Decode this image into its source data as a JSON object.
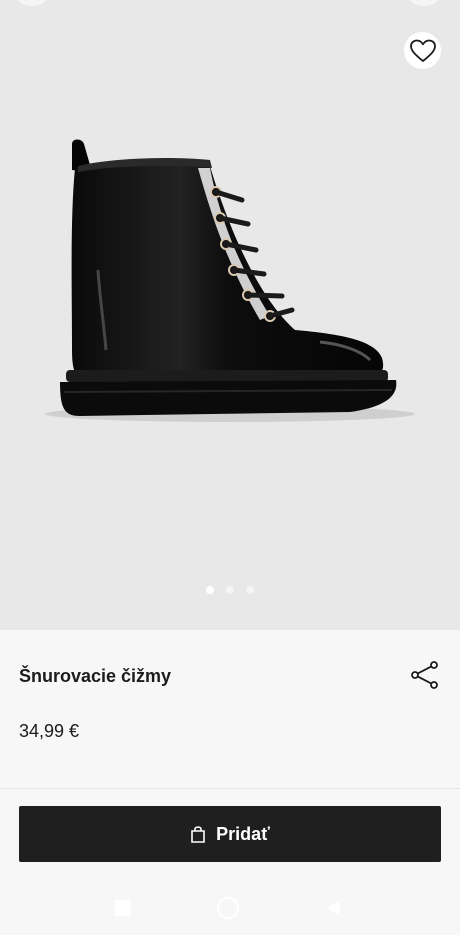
{
  "product": {
    "title": "Šnurovacie čižmy",
    "price": "34,99 €",
    "image_icon": "black-patent-lace-up-boot",
    "gallery": {
      "total": 3,
      "active_index": 0
    }
  },
  "actions": {
    "add_label": "Pridať",
    "favorite_icon": "heart-icon",
    "share_icon": "share-icon",
    "bag_icon": "shopping-bag-icon"
  },
  "colors": {
    "hero_background": "#e8e8e8",
    "button": "#1f1f1f",
    "button_text": "#ffffff"
  },
  "system_nav": [
    "recent-apps-icon",
    "home-icon",
    "back-icon"
  ]
}
